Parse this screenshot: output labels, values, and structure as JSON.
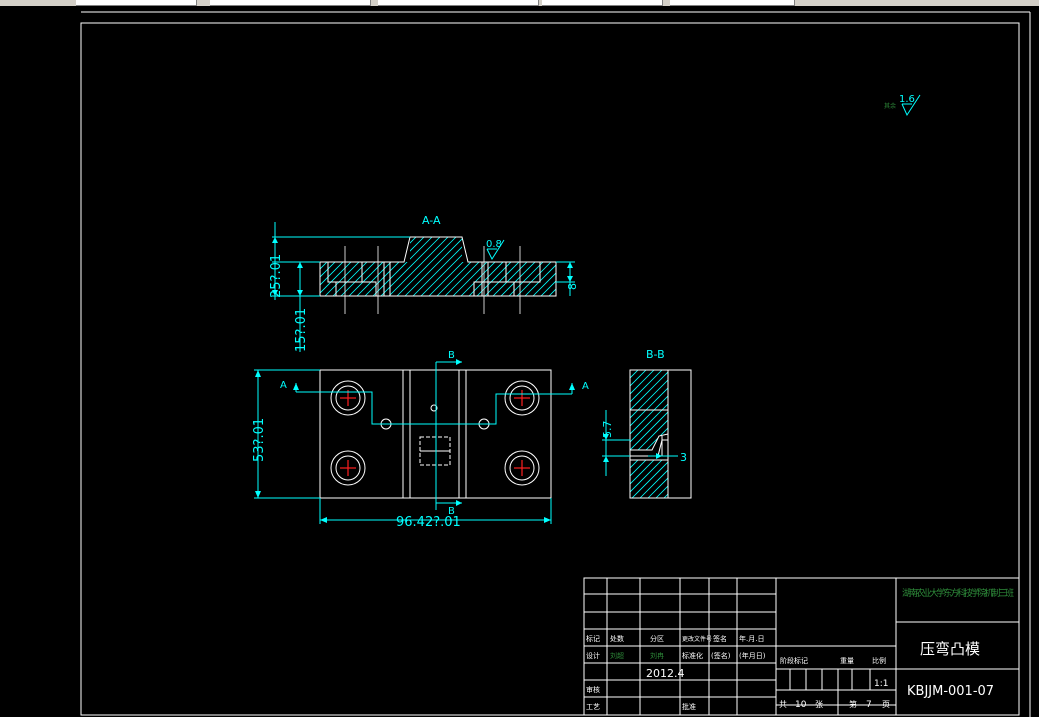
{
  "section_aa_label": "A-A",
  "section_bb_label": "B-B",
  "cut_a": "A",
  "cut_b": "B",
  "roughness_general": "1.6",
  "roughness_general_prefix": "其余",
  "roughness_local": "0.8",
  "dims": {
    "height_25": "25?.01",
    "height_15": "15?.01",
    "thk_8": "8",
    "height_53": "53?.01",
    "width_96": "96.42?.01",
    "dim_5_7": "5.7",
    "dim_3": "3"
  },
  "title_block": {
    "school": "湖南农业大学东方科技学院机制三班",
    "part_name": "压弯凸模",
    "drawing_no": "KBJJM-001-07",
    "scale": "1:1",
    "sheets_total_prefix": "共",
    "sheets_total": "10",
    "sheets_unit": "张",
    "sheet_no_prefix": "第",
    "sheet_no": "7",
    "sheet_unit": "页",
    "date": "2012.4",
    "rev_headers": [
      "标记",
      "处数",
      "分区",
      "更改文件号",
      "签名",
      "年.月.日"
    ],
    "sign_headers": [
      "设计",
      "(签名)",
      "(日期)",
      "标准化",
      "(签名)",
      "(年月日)"
    ],
    "role_check": "审核",
    "role_process": "工艺",
    "role_approve": "批准",
    "stage_headers": [
      "阶段标记",
      "重量",
      "比例"
    ],
    "signer_green_1": "刘超",
    "signer_green_2": "刘冉"
  }
}
